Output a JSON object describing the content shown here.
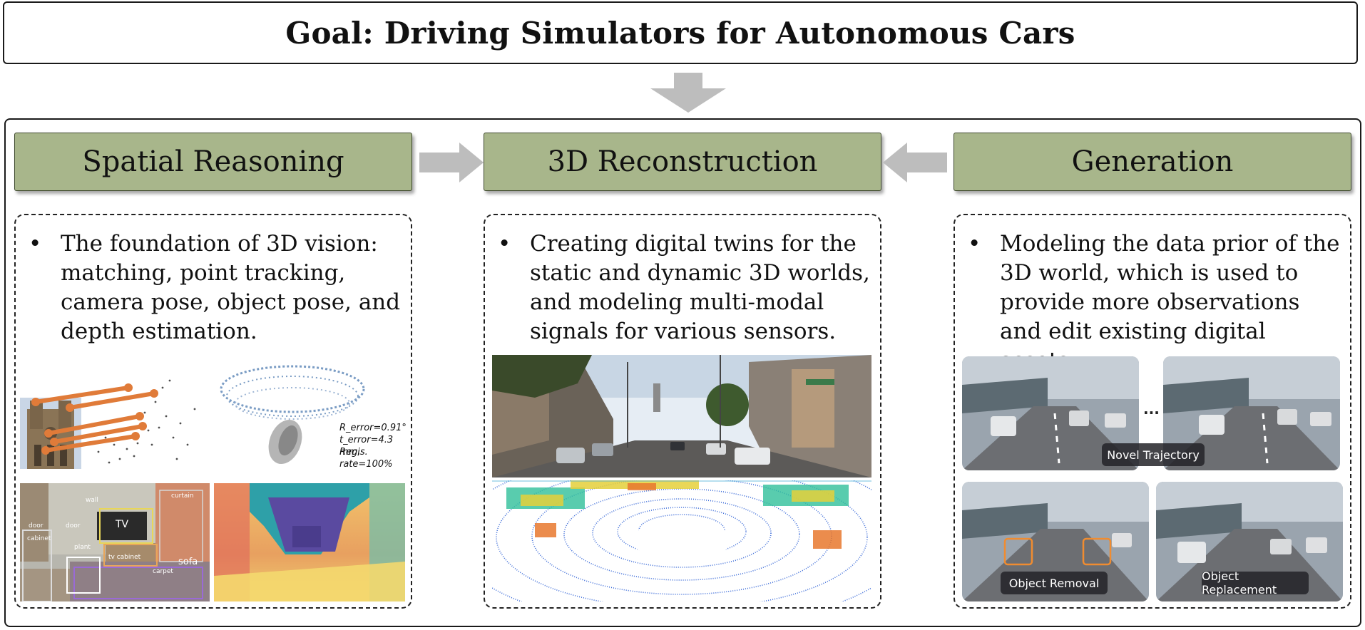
{
  "goal": {
    "title": "Goal: Driving Simulators for Autonomous Cars"
  },
  "columns": [
    {
      "header": "Spatial Reasoning",
      "bullet": "The foundation of 3D vision: matching, point tracking, camera pose, object pose, and depth estimation."
    },
    {
      "header": "3D Reconstruction",
      "bullet": "Creating digital twins for the static and dynamic 3D worlds, and modeling multi-modal signals for various sensors."
    },
    {
      "header": "Generation",
      "bullet": "Modeling the data prior of the 3D world, which is used to provide more observations and edit existing digital assets."
    }
  ],
  "bullet_symbol": "•",
  "pose_metrics": [
    "R_error=0.91°",
    "t_error=4.3 mm,",
    "Regis. rate=100%"
  ],
  "scene_labels": [
    "door",
    "wall",
    "curtain",
    "TV",
    "door",
    "plant",
    "cabinet",
    "tv cabinet",
    "sofa",
    "carpet"
  ],
  "generation_tags": {
    "novel": "Novel Trajectory",
    "removal": "Object Removal",
    "replacement": "Object Replacement",
    "ellipsis": "..."
  },
  "colors": {
    "header_fill": "#a8b68b",
    "arrow_gray": "#bdbdbd",
    "match_orange": "#e07b39"
  }
}
